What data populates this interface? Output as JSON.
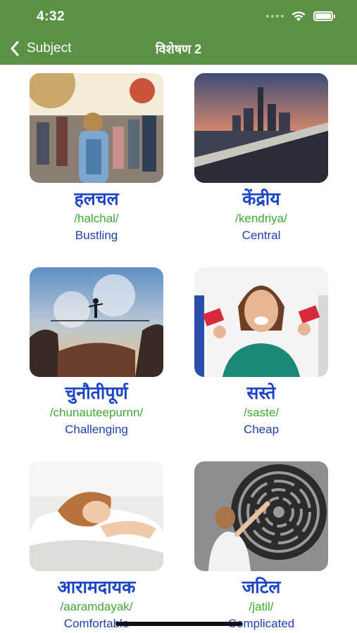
{
  "status_bar": {
    "time": "4:32"
  },
  "nav": {
    "back_label": "Subject",
    "title": "विशेषण 2"
  },
  "words": [
    {
      "word": "हलचल",
      "translit": "/halchal/",
      "meaning": "Bustling",
      "image": "crowd-street-photo"
    },
    {
      "word": "केंद्रीय",
      "translit": "/kendriya/",
      "meaning": "Central",
      "image": "city-skyline-photo"
    },
    {
      "word": "चुनौतीपूर्ण",
      "translit": "/chunauteepurnn/",
      "meaning": "Challenging",
      "image": "tightrope-walker-photo"
    },
    {
      "word": "सस्ते",
      "translit": "/saste/",
      "meaning": "Cheap",
      "image": "woman-sale-tags-photo"
    },
    {
      "word": "आरामदायक",
      "translit": "/aaramdayak/",
      "meaning": "Comfortable",
      "image": "woman-sleeping-pillow-photo"
    },
    {
      "word": "जटिल",
      "translit": "/jatil/",
      "meaning": "Complicated",
      "image": "woman-maze-wall-photo"
    }
  ],
  "colors": {
    "header": "#5b9144",
    "word": "#1d44c7",
    "translit": "#3fa836",
    "meaning": "#1f3fae"
  }
}
